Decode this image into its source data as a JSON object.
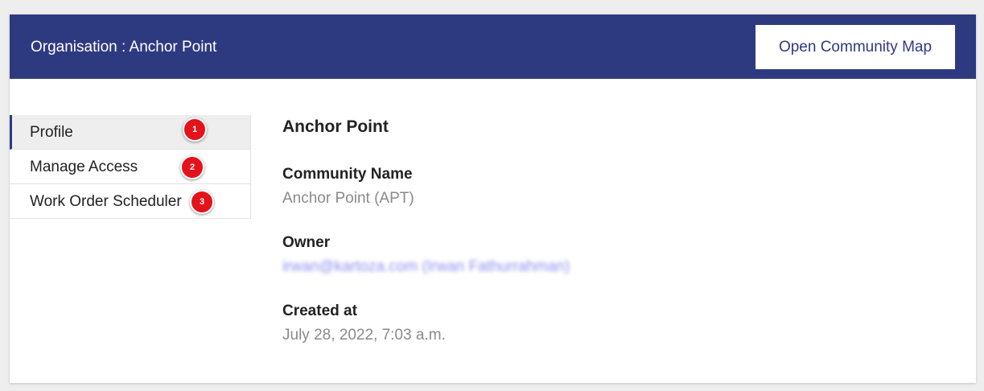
{
  "header": {
    "title": "Organisation : Anchor Point",
    "open_map_button": "Open Community Map",
    "background_color": "#2e3a80"
  },
  "sidebar": {
    "items": [
      {
        "label": "Profile",
        "badge": "1",
        "active": true
      },
      {
        "label": "Manage Access",
        "badge": "2",
        "active": false
      },
      {
        "label": "Work Order Scheduler",
        "badge": "3",
        "active": false
      }
    ],
    "badge_color": "#e4121a"
  },
  "profile": {
    "org_name": "Anchor Point",
    "community_name_label": "Community Name",
    "community_name_value": "Anchor Point (APT)",
    "owner_label": "Owner",
    "owner_value": "irwan@kartoza.com (Irwan Fathurrahman)",
    "created_at_label": "Created at",
    "created_at_value": "July 28, 2022, 7:03 a.m."
  }
}
